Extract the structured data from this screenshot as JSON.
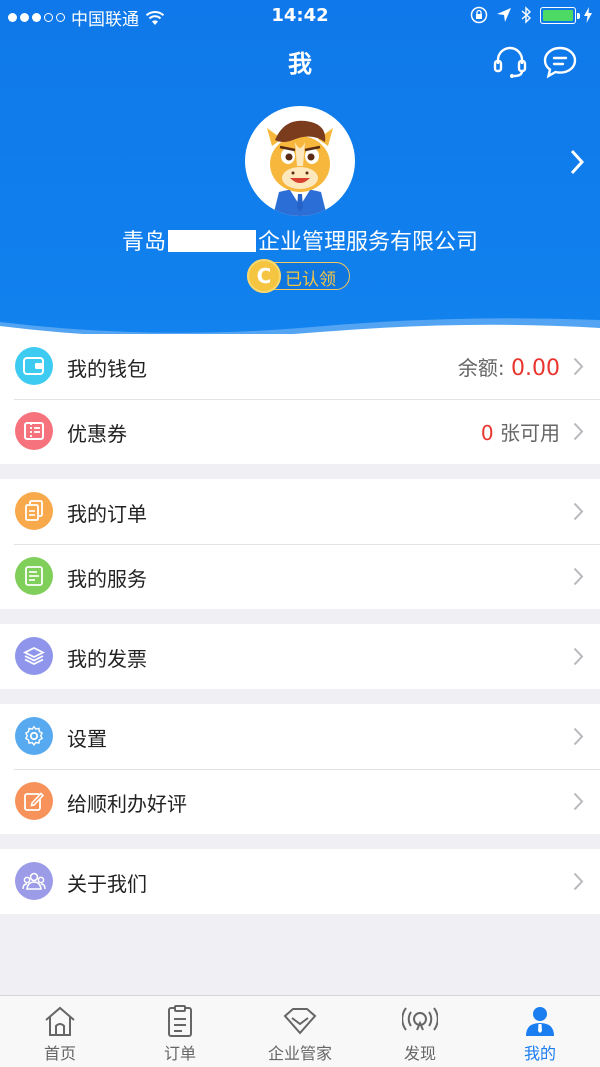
{
  "status_bar": {
    "carrier": "中国联通",
    "time": "14:42"
  },
  "header": {
    "title": "我",
    "company_prefix": "青岛",
    "company_suffix": "企业管理服务有限公司",
    "claim_coin": "C",
    "claim_status": "已认领"
  },
  "groups": {
    "wallet": {
      "label": "我的钱包",
      "balance_label": "余额:",
      "balance_value": "0.00"
    },
    "coupon": {
      "label": "优惠券",
      "count": "0",
      "count_suffix": "张可用"
    },
    "orders": {
      "label": "我的订单"
    },
    "services": {
      "label": "我的服务"
    },
    "invoices": {
      "label": "我的发票"
    },
    "settings": {
      "label": "设置"
    },
    "review": {
      "label": "给顺利办好评"
    },
    "about": {
      "label": "关于我们"
    }
  },
  "colors": {
    "brand_blue": "#1182ee",
    "wallet": "#3ecbf2",
    "coupon": "#f6737e",
    "orders": "#f7a94b",
    "services": "#7fcf5a",
    "invoices": "#8e95ea",
    "settings": "#57aaf0",
    "review": "#f7935a",
    "about": "#9c9be8"
  },
  "tabbar": {
    "items": [
      {
        "label": "首页",
        "icon": "home-icon"
      },
      {
        "label": "订单",
        "icon": "clipboard-icon"
      },
      {
        "label": "企业管家",
        "icon": "diamond-icon"
      },
      {
        "label": "发现",
        "icon": "broadcast-icon"
      },
      {
        "label": "我的",
        "icon": "person-icon",
        "active": true
      }
    ]
  }
}
